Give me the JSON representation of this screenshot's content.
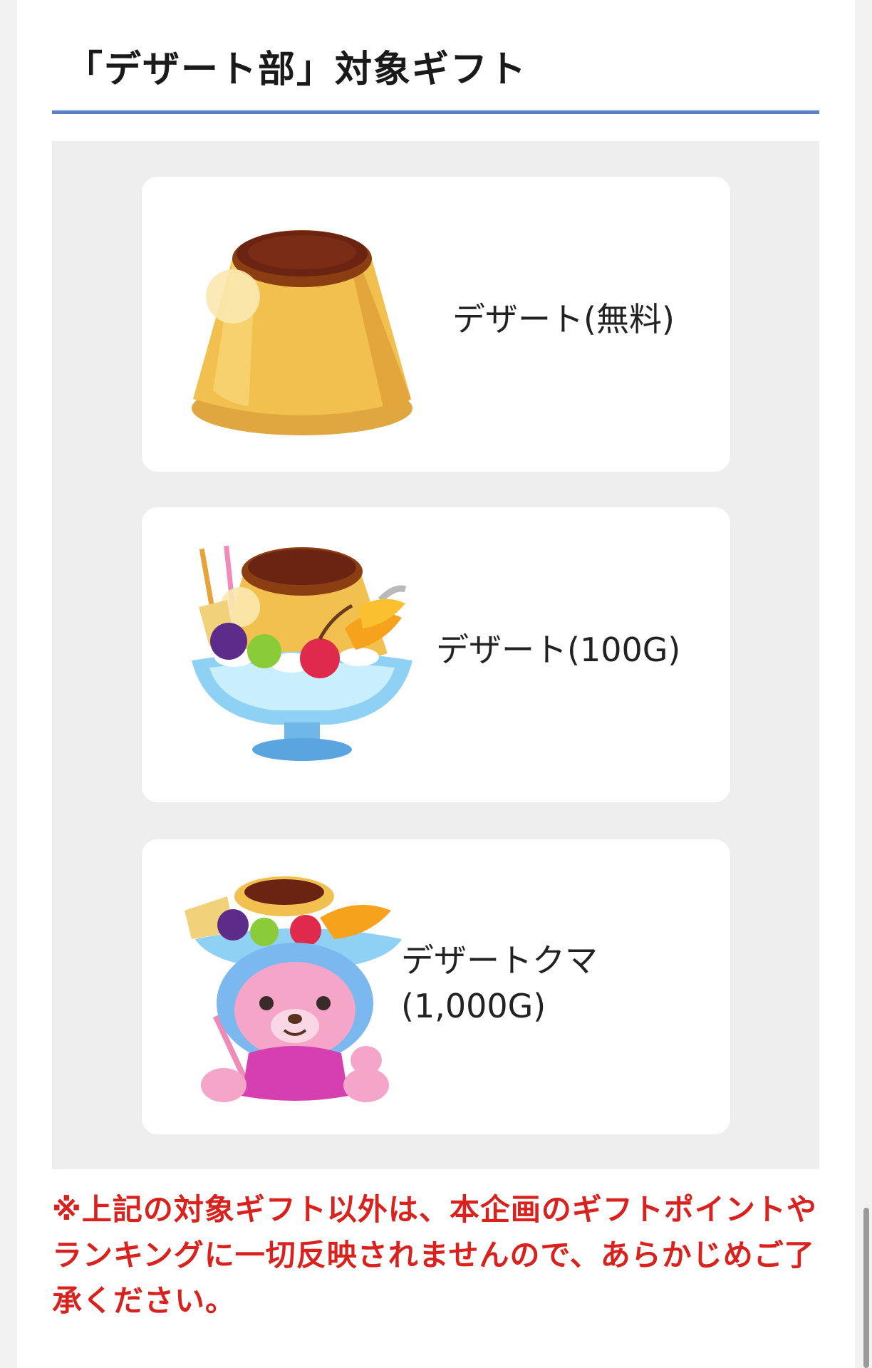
{
  "section": {
    "title": "「デザート部」対象ギフト"
  },
  "gifts": [
    {
      "label": "デザート(無料)",
      "label_line2": "",
      "icon": "pudding-icon"
    },
    {
      "label": "デザート(100G)",
      "label_line2": "",
      "icon": "pudding-parfait-icon"
    },
    {
      "label": "デザートクマ",
      "label_line2": "(1,000G)",
      "icon": "dessert-bear-icon"
    }
  ],
  "notice": {
    "text": "※上記の対象ギフト以外は、本企画のギフトポイントやランキングに一切反映されませんので、あらかじめご了承ください。"
  },
  "colors": {
    "accent_rule": "#5b7fc2",
    "notice_red": "#d9211d",
    "panel_bg": "#eeeeee"
  }
}
